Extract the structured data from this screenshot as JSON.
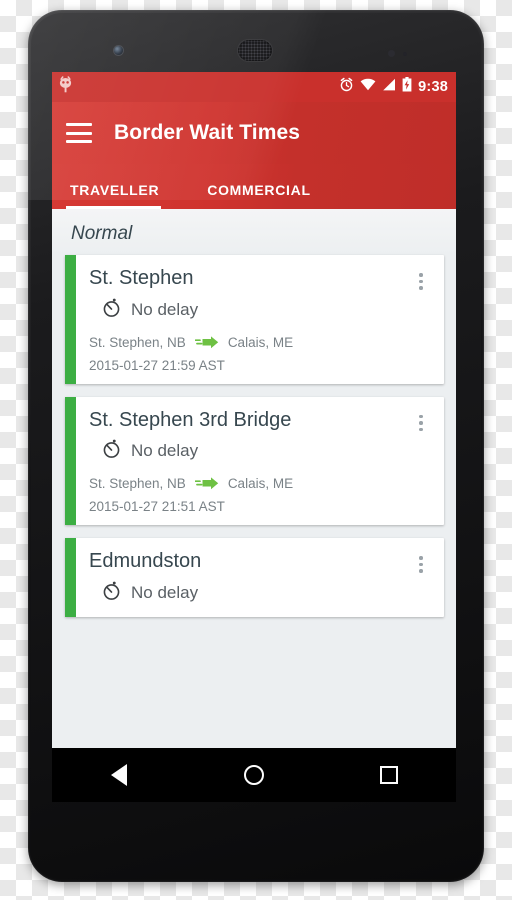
{
  "statusbar": {
    "notification_icon": "android-robot-notification-icon",
    "icons": [
      "alarm-icon",
      "wifi-icon",
      "cellular-signal-icon",
      "battery-charging-icon"
    ],
    "time": "9:38"
  },
  "appbar": {
    "menu_icon": "hamburger-menu-icon",
    "title": "Border Wait Times",
    "background_color": "#c9302c"
  },
  "tabs": [
    {
      "label": "TRAVELLER",
      "active": true
    },
    {
      "label": "COMMERCIAL",
      "active": false
    }
  ],
  "content": {
    "section_header": "Normal",
    "accent_color": "#3cae43",
    "cards": [
      {
        "title": "St. Stephen",
        "delay_icon": "stopwatch-icon",
        "delay": "No delay",
        "origin": "St. Stephen, NB",
        "arrow_icon": "green-arrow-icon",
        "destination": "Calais, ME",
        "timestamp": "2015-01-27 21:59 AST",
        "overflow_icon": "more-vertical-icon"
      },
      {
        "title": "St. Stephen 3rd Bridge",
        "delay_icon": "stopwatch-icon",
        "delay": "No delay",
        "origin": "St. Stephen, NB",
        "arrow_icon": "green-arrow-icon",
        "destination": "Calais, ME",
        "timestamp": "2015-01-27 21:51 AST",
        "overflow_icon": "more-vertical-icon"
      },
      {
        "title": "Edmundston",
        "delay_icon": "stopwatch-icon",
        "delay": "No delay",
        "origin": "",
        "arrow_icon": "green-arrow-icon",
        "destination": "",
        "timestamp": "",
        "overflow_icon": "more-vertical-icon"
      }
    ]
  },
  "navbar": {
    "back": "back-nav-icon",
    "home": "home-nav-icon",
    "recents": "recents-nav-icon"
  }
}
